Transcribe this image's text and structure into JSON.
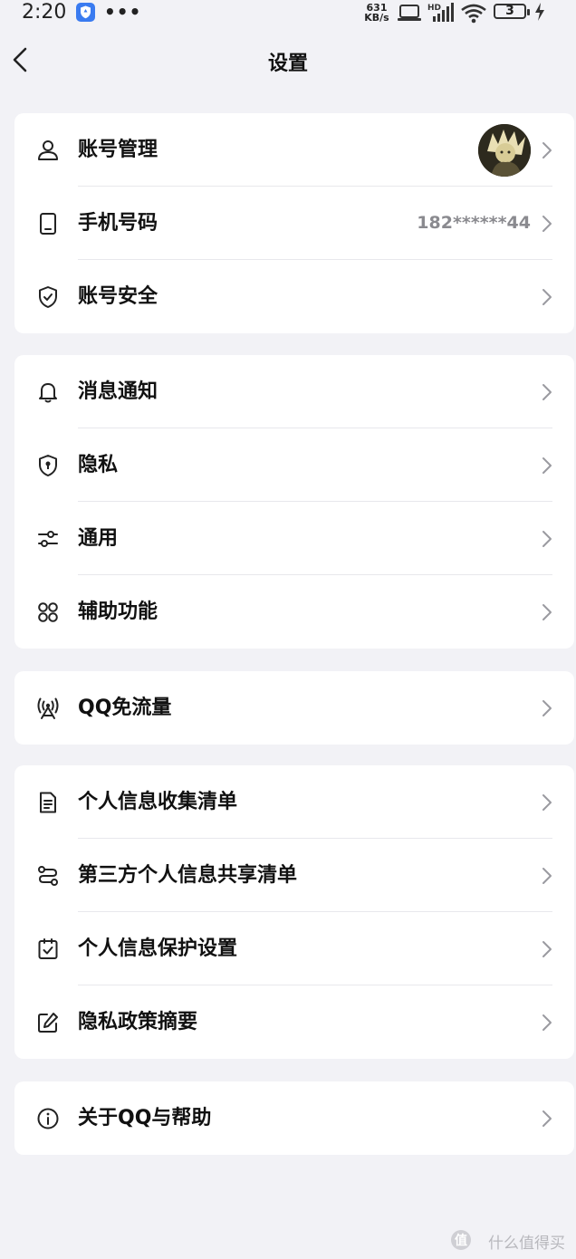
{
  "status_bar": {
    "time": "2:20",
    "more": "•••",
    "net_speed_value": "631",
    "net_speed_unit": "KB/s",
    "network_label": "HD",
    "battery": "3"
  },
  "header": {
    "title": "设置"
  },
  "groups": [
    {
      "items": [
        {
          "label": "账号管理",
          "icon": "person-icon"
        },
        {
          "label": "手机号码",
          "icon": "phone-icon",
          "value": "182******44"
        },
        {
          "label": "账号安全",
          "icon": "shield-check-icon"
        }
      ]
    },
    {
      "items": [
        {
          "label": "消息通知",
          "icon": "bell-icon"
        },
        {
          "label": "隐私",
          "icon": "shield-lock-icon"
        },
        {
          "label": "通用",
          "icon": "sliders-icon"
        },
        {
          "label": "辅助功能",
          "icon": "grid-icon"
        }
      ]
    },
    {
      "items": [
        {
          "label": "QQ免流量",
          "icon": "signal-tower-icon"
        }
      ]
    },
    {
      "items": [
        {
          "label": "个人信息收集清单",
          "icon": "document-icon"
        },
        {
          "label": "第三方个人信息共享清单",
          "icon": "share-route-icon"
        },
        {
          "label": "个人信息保护设置",
          "icon": "checkbox-icon"
        },
        {
          "label": "隐私政策摘要",
          "icon": "edit-icon"
        }
      ]
    },
    {
      "items": [
        {
          "label": "关于QQ与帮助",
          "icon": "info-icon"
        }
      ]
    }
  ],
  "watermark": {
    "badge": "值",
    "text": "什么值得买"
  },
  "colors": {
    "background": "#f2f2f6",
    "card": "#ffffff",
    "value_text": "#8a8a8f",
    "chevron": "#9a9aa0"
  }
}
